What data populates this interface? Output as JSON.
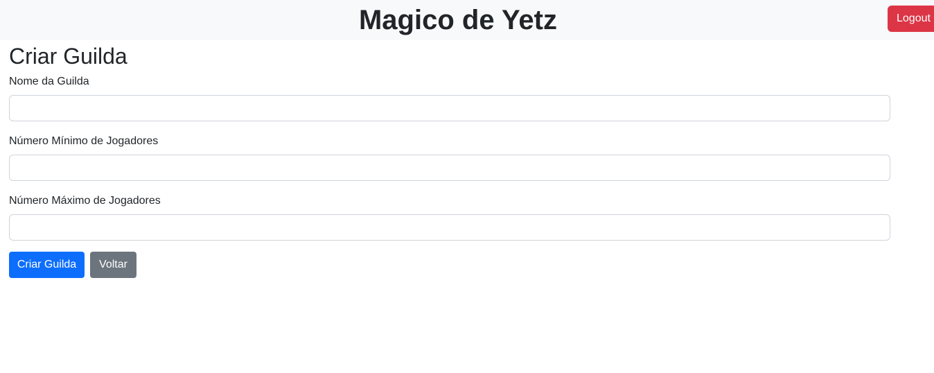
{
  "header": {
    "title": "Magico de Yetz",
    "logout_label": "Logout"
  },
  "form": {
    "heading": "Criar Guilda",
    "fields": [
      {
        "label": "Nome da Guilda",
        "value": "",
        "placeholder": ""
      },
      {
        "label": "Número Mínimo de Jogadores",
        "value": "",
        "placeholder": ""
      },
      {
        "label": "Número Máximo de Jogadores",
        "value": "",
        "placeholder": ""
      }
    ],
    "submit_label": "Criar Guilda",
    "back_label": "Voltar"
  },
  "colors": {
    "header_bg": "#f8f9fa",
    "logout": "#dc3545",
    "primary": "#0d6efd",
    "secondary": "#6c757d"
  }
}
